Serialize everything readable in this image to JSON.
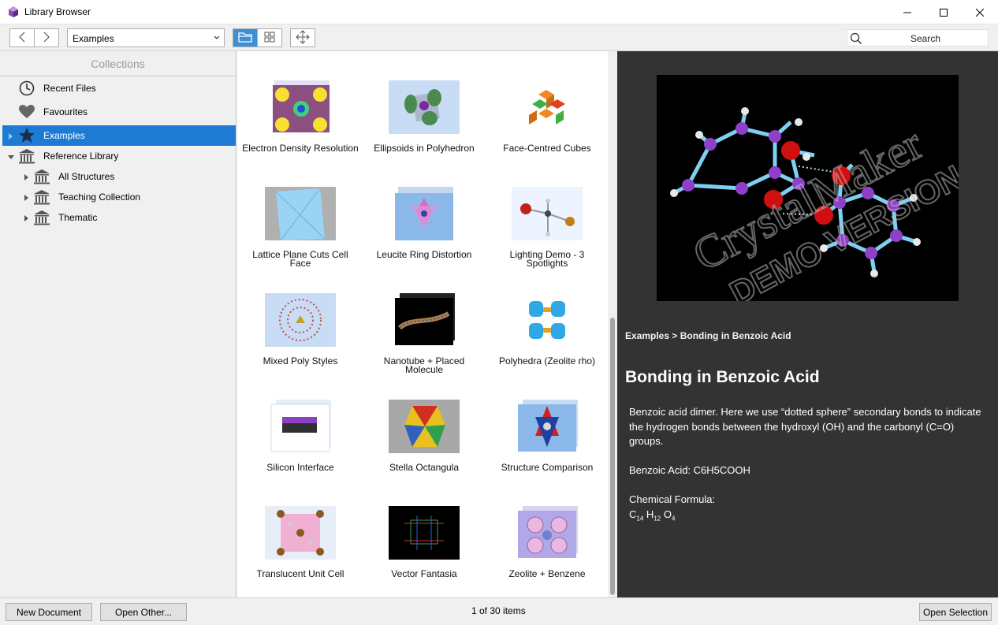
{
  "window": {
    "title": "Library Browser"
  },
  "toolbar": {
    "collection_combo": "Examples",
    "search_placeholder": "Search"
  },
  "sidebar": {
    "header": "Collections",
    "items": [
      {
        "label": "Recent Files",
        "icon": "clock-icon"
      },
      {
        "label": "Favourites",
        "icon": "heart-icon"
      },
      {
        "label": "Examples",
        "icon": "star-icon",
        "selected": true
      },
      {
        "label": "Reference Library",
        "icon": "library-icon"
      },
      {
        "label": "All Structures",
        "icon": "library-icon"
      },
      {
        "label": "Teaching Collection",
        "icon": "library-icon"
      },
      {
        "label": "Thematic",
        "icon": "library-icon"
      }
    ]
  },
  "grid": {
    "items": [
      {
        "label": "Electron Density Resolution"
      },
      {
        "label": "Ellipsoids in Polyhedron"
      },
      {
        "label": "Face-Centred Cubes"
      },
      {
        "label": "Lattice Plane Cuts Cell Face"
      },
      {
        "label": "Leucite Ring Distortion"
      },
      {
        "label": "Lighting Demo - 3 Spotlights"
      },
      {
        "label": "Mixed Poly Styles"
      },
      {
        "label": "Nanotube + Placed Molecule"
      },
      {
        "label": "Polyhedra (Zeolite rho)"
      },
      {
        "label": "Silicon Interface"
      },
      {
        "label": "Stella Octangula"
      },
      {
        "label": "Structure Comparison"
      },
      {
        "label": "Translucent Unit Cell"
      },
      {
        "label": "Vector Fantasia"
      },
      {
        "label": "Zeolite + Benzene"
      }
    ]
  },
  "details": {
    "breadcrumb": "Examples > Bonding in Benzoic Acid",
    "title": "Bonding in Benzoic Acid",
    "description": "Benzoic acid dimer. Here we use “dotted sphere” secondary bonds to indicate the hydrogen bonds between the hydroxyl (OH) and the carbonyl (C=O) groups.",
    "acid_line": "Benzoic Acid: C6H5COOH",
    "formula_label": "Chemical Formula:",
    "formula": {
      "c": "C",
      "c_n": "14",
      "h": "H",
      "h_n": "12",
      "o": "O",
      "o_n": "4"
    },
    "watermark_1": "CrystalMaker",
    "watermark_2": "DEMO VERSION"
  },
  "status": {
    "new_document": "New Document",
    "open_other": "Open Other...",
    "count": "1 of 30 items",
    "open_selection": "Open Selection"
  },
  "colors": {
    "accent": "#1e7bd4",
    "detail_bg": "#333333"
  }
}
